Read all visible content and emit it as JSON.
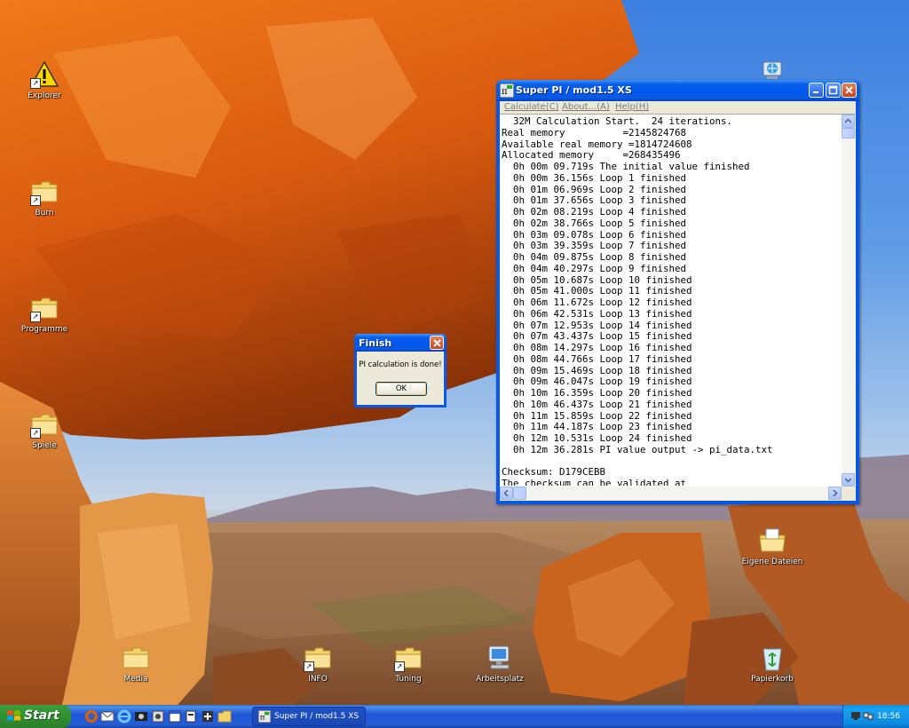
{
  "desktop": {
    "icons_left": [
      {
        "label": "Explorer",
        "icon": "warning-icon"
      },
      {
        "label": "Burn",
        "icon": "folder-icon"
      },
      {
        "label": "Programme",
        "icon": "folder-icon"
      },
      {
        "label": "Spiele",
        "icon": "folder-icon"
      }
    ],
    "icons_bottom": [
      {
        "label": "Media",
        "icon": "folder-icon"
      },
      {
        "label": "INFO",
        "icon": "folder-icon"
      },
      {
        "label": "Tuning",
        "icon": "folder-icon"
      },
      {
        "label": "Arbeitsplatz",
        "icon": "computer-icon"
      },
      {
        "label": "Papierkorb",
        "icon": "recycle-bin-icon"
      }
    ],
    "icons_right": [
      {
        "label": "Eigene Dateien",
        "icon": "documents-folder-icon"
      },
      {
        "label": "",
        "icon": "globe-icon"
      }
    ]
  },
  "superpi": {
    "title": "Super PI / mod1.5 XS",
    "menu": [
      "Calculate(C)",
      "About...(A)",
      "Help(H)"
    ],
    "lines": [
      "  32M Calculation Start.  24 iterations.",
      "Real memory          =2145824768",
      "Available real memory =1814724608",
      "Allocated memory     =268435496",
      "  0h 00m 09.719s The initial value finished",
      "  0h 00m 36.156s Loop 1 finished",
      "  0h 01m 06.969s Loop 2 finished",
      "  0h 01m 37.656s Loop 3 finished",
      "  0h 02m 08.219s Loop 4 finished",
      "  0h 02m 38.766s Loop 5 finished",
      "  0h 03m 09.078s Loop 6 finished",
      "  0h 03m 39.359s Loop 7 finished",
      "  0h 04m 09.875s Loop 8 finished",
      "  0h 04m 40.297s Loop 9 finished",
      "  0h 05m 10.687s Loop 10 finished",
      "  0h 05m 41.000s Loop 11 finished",
      "  0h 06m 11.672s Loop 12 finished",
      "  0h 06m 42.531s Loop 13 finished",
      "  0h 07m 12.953s Loop 14 finished",
      "  0h 07m 43.437s Loop 15 finished",
      "  0h 08m 14.297s Loop 16 finished",
      "  0h 08m 44.766s Loop 17 finished",
      "  0h 09m 15.469s Loop 18 finished",
      "  0h 09m 46.047s Loop 19 finished",
      "  0h 10m 16.359s Loop 20 finished",
      "  0h 10m 46.437s Loop 21 finished",
      "  0h 11m 15.859s Loop 22 finished",
      "  0h 11m 44.187s Loop 23 finished",
      "  0h 12m 10.531s Loop 24 finished",
      "  0h 12m 36.281s PI value output -> pi_data.txt",
      "",
      "Checksum: D179CEBB",
      "The checksum can be validated at"
    ]
  },
  "dialog": {
    "title": "Finish",
    "message": "PI calculation is done!",
    "ok_label": "OK"
  },
  "taskbar": {
    "start_label": "Start",
    "quicklaunch": [
      "firefox-icon",
      "outlook-icon",
      "ie-icon",
      "media-icon",
      "app-icon",
      "window-icon",
      "app2-icon",
      "network-icon",
      "explorer-icon"
    ],
    "task_button": "Super PI / mod1.5 XS",
    "clock": "18:56"
  },
  "colors": {
    "xp_blue": "#0a58e6",
    "start_green": "#379a37",
    "tray_blue": "#0c8be0"
  }
}
